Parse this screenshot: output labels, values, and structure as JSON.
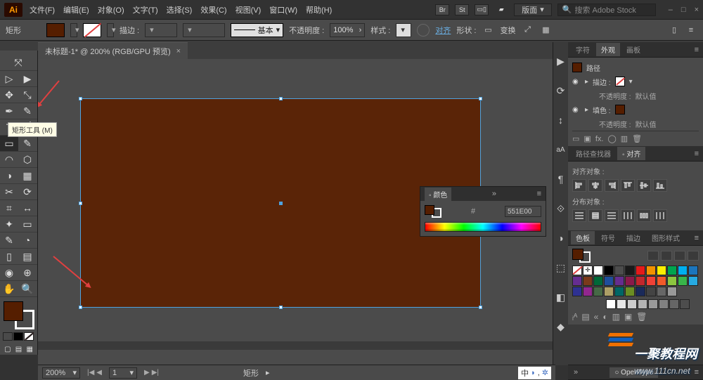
{
  "title_logo": "Ai",
  "menu": {
    "file": "文件(F)",
    "edit": "编辑(E)",
    "object": "对象(O)",
    "type": "文字(T)",
    "select": "选择(S)",
    "effect": "效果(C)",
    "view": "视图(V)",
    "window": "窗口(W)",
    "help": "帮助(H)"
  },
  "titlebar_right": {
    "br": "Br",
    "st": "St",
    "arrange": "▭▯",
    "cloud": "▰",
    "workspace": "版面",
    "workspace_ar": "▾",
    "search_icon": "🔍",
    "search_ph": "搜索 Adobe Stock"
  },
  "win_controls": {
    "min": "–",
    "max": "□",
    "close": "×"
  },
  "control": {
    "tool_label": "矩形",
    "stroke_label": "描边 :",
    "stroke_ar": "▾",
    "stroke_width_ar": "▾",
    "basic": "基本",
    "basic_ar": "▾",
    "opacity_label": "不透明度 :",
    "opacity_value": "100%",
    "opacity_ar": "›",
    "style_label": "样式 :",
    "align": "对齐",
    "shape": "形状 :",
    "transform": "变换",
    "expand_icon": "⤢",
    "crop_icon": "▦"
  },
  "tab": {
    "title": "未标题-1* @ 200% (RGB/GPU 预览)",
    "close": "×"
  },
  "toolbox": {
    "grab": "⤧",
    "row1a": "▷",
    "row1b": "▶",
    "row2a": "✥",
    "row2b": "⤡",
    "row3a": "✒",
    "row3b": "✎",
    "row4a": "T",
    "row4b": "╱",
    "row5a": "▭",
    "row5b": "✎",
    "row6a": "◠",
    "row6b": "⬡",
    "row7a": "◑",
    "row7b": "▦",
    "row8a": "✂",
    "row8b": "⟳",
    "row9a": "⌗",
    "row9b": "↔",
    "row10a": "✦",
    "row10b": "▭",
    "row11a": "✎",
    "row11b": "◔",
    "row12a": "▯",
    "row12b": "▤",
    "row13a": "◉",
    "row13b": "⊕",
    "row14a": "✋",
    "row14b": "🔍",
    "mini1_bg": "#7a3a1a",
    "mini2_bg": "#000",
    "mini3_bg": "#fff",
    "screen1": "▢",
    "screen2": "▤",
    "screen3": "▦"
  },
  "tooltip": "矩形工具 (M)",
  "right_strip": {
    "i1": "▶",
    "i2": "⟳",
    "i3": "↕",
    "i4": "aA",
    "i5": "¶",
    "i6": "⟐",
    "i7": "◑",
    "i8": "⬚",
    "i9": "◧",
    "i10": "◆"
  },
  "panels": {
    "tabs1": {
      "char": "字符",
      "appearance": "外观",
      "artboard": "画板"
    },
    "appearance": {
      "path": "路径",
      "eye": "◉",
      "arrow": "▸",
      "stroke_label": "描边 :",
      "stroke_ar": "▾",
      "opacity_label": "不透明度 :",
      "opacity_val": "默认值",
      "fill_label": "填色 :",
      "footer": {
        "i1": "▭",
        "i2": "▣",
        "i3": "fx.",
        "i4": "◯",
        "i5": "▥",
        "i6": "🗑"
      }
    },
    "tabs2": {
      "pathfinder": "路径查找器",
      "align": "◦ 对齐"
    },
    "align": {
      "align_label": "对齐对象 :",
      "dist_label": "分布对象 :"
    },
    "tabs3": {
      "swatches": "色板",
      "symbols": "符号",
      "brushes": "描边",
      "styles": "图形样式"
    },
    "swatches": {
      "row1": [
        "none",
        "reg",
        "#ffffff",
        "#000000",
        "#4d4d4d",
        "#1a1a1a",
        "#e51a1a",
        "#f29200",
        "#fdee00",
        "#00a54f",
        "#00aeef",
        "#1c75bc",
        "#662d91"
      ],
      "row2": [
        "#7a3a1a",
        "#006838",
        "#1f4e9b",
        "#652d8f",
        "#8a1a4a",
        "#c1272d",
        "#ef4136",
        "#f15a29",
        "#8cc63f",
        "#39b54a",
        "#27aae1",
        "#2e3192",
        "#92278f"
      ],
      "row3": [
        "#466946",
        "#ad9f66",
        "#006666",
        "#6b8e23",
        "#1a2a5a",
        "#444",
        "#666",
        "#999"
      ],
      "row4_gray": [
        "#fff",
        "#e6e6e6",
        "#ccc",
        "#b3b3b3",
        "#999",
        "#808080",
        "#666",
        "#4d4d4d"
      ],
      "footer": {
        "i1": "ᵢᴬ",
        "i2": "▤",
        "i3": "«",
        "i4": "◐",
        "i5": "▥",
        "i6": "▣",
        "i7": "🗑"
      }
    },
    "bottom_panel": {
      "tab": "○ OpenType",
      "chev_r": "»"
    }
  },
  "color_panel": {
    "tab": "◦ 颜色",
    "chev_r": "»",
    "hex_sym": "#",
    "hex_val": "551E00"
  },
  "status": {
    "zoom": "200%",
    "zoom_ar": "▾",
    "nav_first": "|◀",
    "nav_prev": "◀",
    "page": "1",
    "page_ar": "▾",
    "nav_next": "▶",
    "nav_last": "▶|",
    "sel_label": "矩形",
    "sel_ar": "▸",
    "gpu_center": "中",
    "moon": "◗",
    "gear": "✲"
  },
  "watermark": {
    "brand": "一聚教程网",
    "url": "www.111cn.net"
  },
  "colors": {
    "fill": "#551e00",
    "accent_blue": "#4fa3e0"
  },
  "menubtn": "≡"
}
